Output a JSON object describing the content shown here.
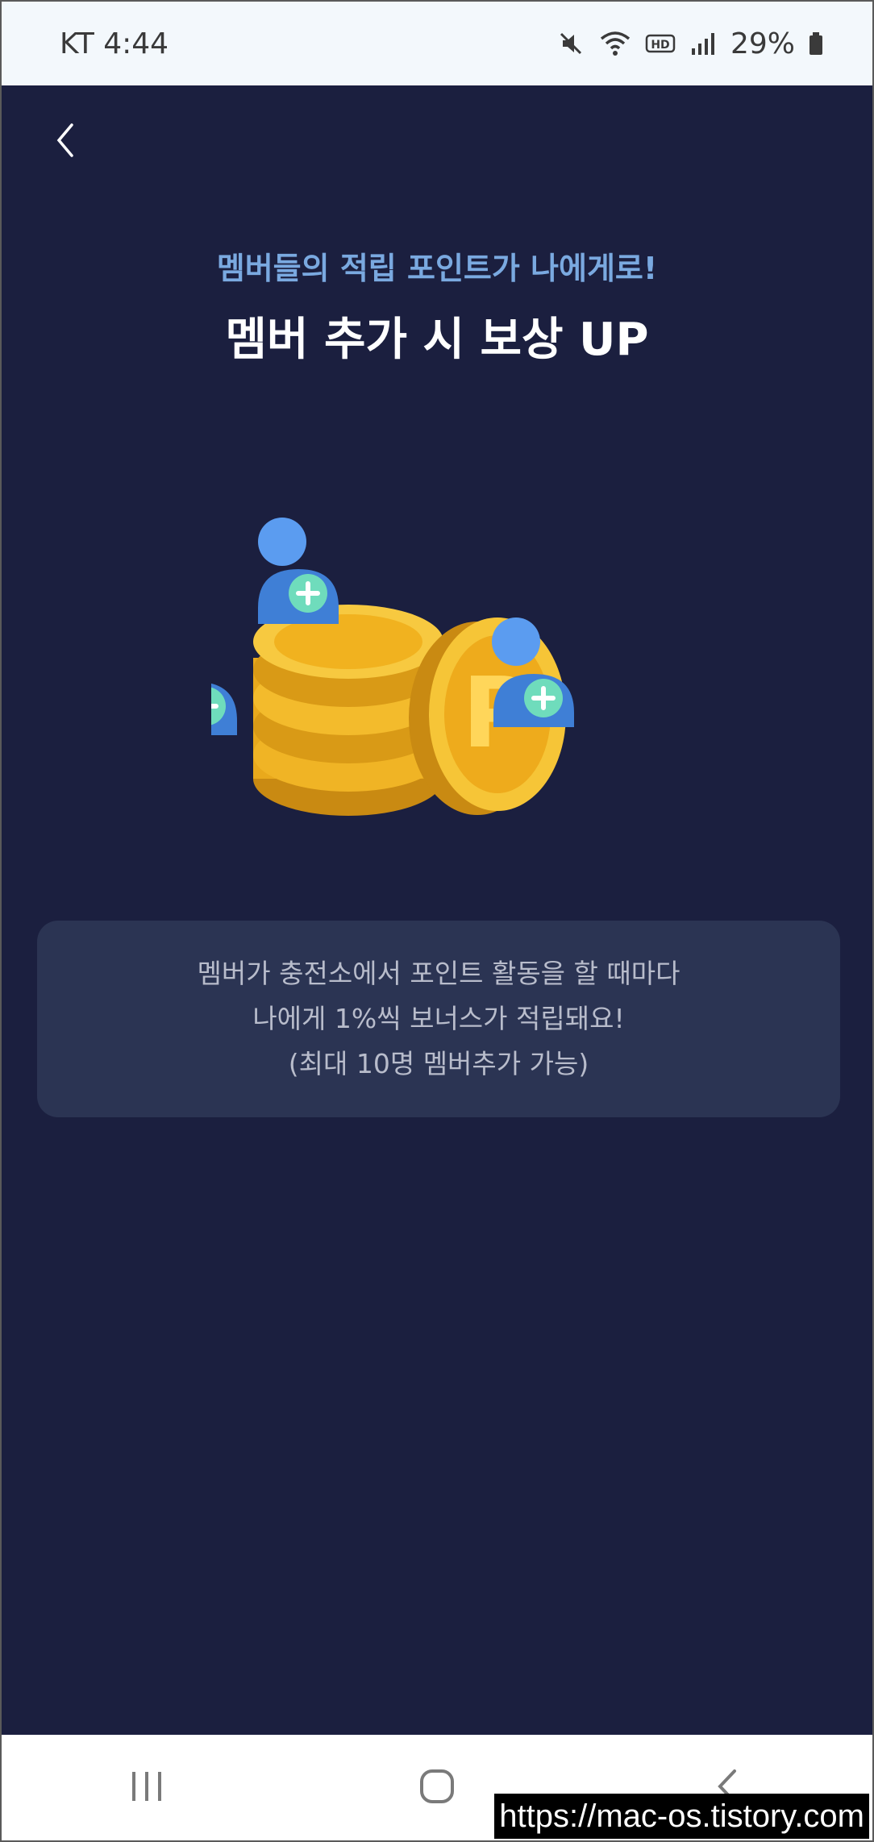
{
  "status_bar": {
    "carrier_time": "KT 4:44",
    "icons": [
      "mute-icon",
      "wifi-icon",
      "hd-icon",
      "signal-icon"
    ],
    "battery": "29%"
  },
  "header": {
    "back_icon": "chevron-left-icon",
    "subtitle": "멤버들의 적립 포인트가 나에게로!",
    "title": "멤버 추가 시 보상 UP"
  },
  "illustration": {
    "icons": [
      "coin-stack-icon",
      "point-coin-icon",
      "add-member-icon"
    ],
    "coin_letter": "P"
  },
  "info": {
    "line1": "멤버가 충전소에서 포인트 활동을 할 때마다",
    "line2": "나에게 1%씩 보너스가 적립돼요!",
    "line3": "(최대 10명 멤버추가 가능)"
  },
  "nav_bar": {
    "icons": [
      "recent-apps-icon",
      "home-icon",
      "back-icon"
    ]
  },
  "watermark": "https://mac-os.tistory.com",
  "colors": {
    "background": "#1b1f3f",
    "subtitle": "#7aa9e0",
    "info_box": "#2b3453",
    "coin": "#f2b21f",
    "member": "#4b8fe8",
    "plus": "#5fd3b0"
  }
}
